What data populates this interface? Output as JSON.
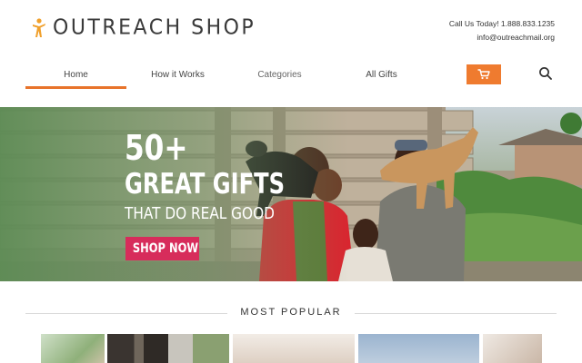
{
  "header": {
    "logo_text": "OUTREACH SHOP",
    "phone": "Call Us Today! 1.888.833.1235",
    "email": "info@outreachmail.org"
  },
  "nav": {
    "items": [
      {
        "label": "Home",
        "active": true
      },
      {
        "label": "How it Works",
        "active": false
      },
      {
        "label": "Categories",
        "active": false
      },
      {
        "label": "All Gifts",
        "active": false
      }
    ],
    "cart_icon": "cart-icon",
    "search_icon": "search-icon"
  },
  "hero": {
    "line1": "50+",
    "line2": "GREAT GIFTS",
    "line3": "THAT DO REAL GOOD",
    "cta": "SHOP NOW"
  },
  "popular": {
    "title": "MOST POPULAR"
  },
  "colors": {
    "accent_orange": "#ef7b2f",
    "cta_pink": "#d72c5b",
    "nav_underline": "#e8732a"
  }
}
